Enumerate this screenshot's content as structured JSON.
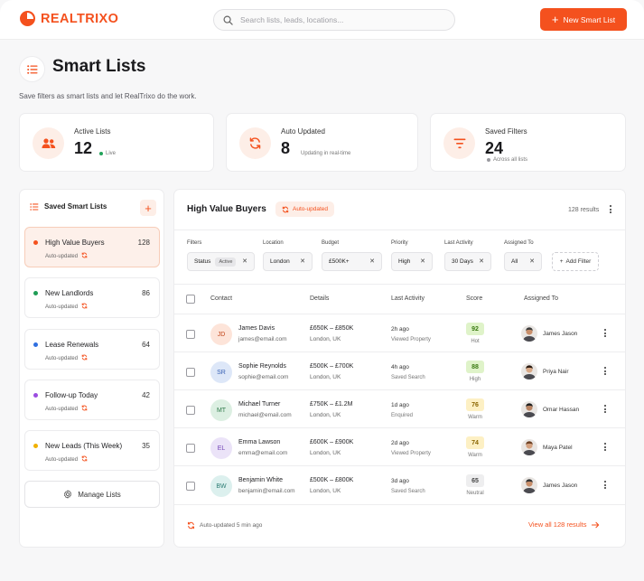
{
  "brand": {
    "name": "REALTRIXO",
    "accent": "#f4511e"
  },
  "search": {
    "placeholder": "Search lists, leads, locations..."
  },
  "header": {
    "new_button_label": "New Smart List"
  },
  "page": {
    "title": "Smart Lists",
    "subtitle": "Save filters as smart lists and let RealTrixo do the work."
  },
  "stats": [
    {
      "label": "Active Lists",
      "value": "12",
      "meta": "Live",
      "meta_color": "#22a35a",
      "icon": "users-icon"
    },
    {
      "label": "Auto Updated",
      "value": "8",
      "meta": "Updating in real-time",
      "meta_color": "",
      "icon": "refresh-icon"
    },
    {
      "label": "Saved Filters",
      "value": "24",
      "meta": "Across all lists",
      "meta_color": "#9a9aa0",
      "icon": "filter-icon"
    }
  ],
  "sidebar": {
    "title": "Saved Smart Lists",
    "items": [
      {
        "name": "High Value Buyers",
        "count": "128",
        "sub": "Auto-updated",
        "color": "#f4511e",
        "active": true
      },
      {
        "name": "New Landlords",
        "count": "86",
        "sub": "Auto-updated",
        "color": "#1f9d55",
        "active": false
      },
      {
        "name": "Lease Renewals",
        "count": "64",
        "sub": "Auto-updated",
        "color": "#2f6fe0",
        "active": false
      },
      {
        "name": "Follow-up Today",
        "count": "42",
        "sub": "Auto-updated",
        "color": "#9b4de0",
        "active": false
      },
      {
        "name": "New Leads (This Week)",
        "count": "35",
        "sub": "Auto-updated",
        "color": "#f0b000",
        "active": false
      }
    ],
    "manage_label": "Manage Lists"
  },
  "main": {
    "title": "High Value Buyers",
    "badge": "Auto-updated",
    "results": "128 results",
    "filters": [
      {
        "label": "Filters",
        "value": "Status",
        "pill": "Active"
      },
      {
        "label": "Location",
        "value": "London",
        "pill": ""
      },
      {
        "label": "Budget",
        "value": "£500K+",
        "pill": ""
      },
      {
        "label": "Priority",
        "value": "High",
        "pill": ""
      },
      {
        "label": "Last Activity",
        "value": "30 Days",
        "pill": ""
      },
      {
        "label": "Assigned To",
        "value": "All",
        "pill": ""
      }
    ],
    "add_filter_label": "Add Filter",
    "columns": [
      "Contact",
      "Details",
      "Last Activity",
      "Score",
      "Assigned To"
    ],
    "rows": [
      {
        "initials": "JD",
        "name": "James Davis",
        "email": "james@email.com",
        "price": "£650K – £850K",
        "location": "London, UK",
        "activity": "2h ago",
        "activity_sub": "Viewed Property",
        "score": "92",
        "score_label": "Hot",
        "score_bg": "#dff3c9",
        "score_fg": "#3a7a12",
        "av_bg": "#fde4d9",
        "av_fg": "#c2461b",
        "assignee": "James Jason"
      },
      {
        "initials": "SR",
        "name": "Sophie Reynolds",
        "email": "sophie@email.com",
        "price": "£500K – £700K",
        "location": "London, UK",
        "activity": "4h ago",
        "activity_sub": "Saved Search",
        "score": "88",
        "score_label": "High",
        "score_bg": "#dff3c9",
        "score_fg": "#3a7a12",
        "av_bg": "#dde7f8",
        "av_fg": "#3b63b5",
        "assignee": "Priya Nair"
      },
      {
        "initials": "MT",
        "name": "Michael Turner",
        "email": "michael@email.com",
        "price": "£750K – £1.2M",
        "location": "London, UK",
        "activity": "1d ago",
        "activity_sub": "Enquired",
        "score": "76",
        "score_label": "Warm",
        "score_bg": "#fdf0c4",
        "score_fg": "#8a6500",
        "av_bg": "#dcefe2",
        "av_fg": "#2f7a4a",
        "assignee": "Omar Hassan"
      },
      {
        "initials": "EL",
        "name": "Emma Lawson",
        "email": "emma@email.com",
        "price": "£600K – £900K",
        "location": "London, UK",
        "activity": "2d ago",
        "activity_sub": "Viewed Property",
        "score": "74",
        "score_label": "Warm",
        "score_bg": "#fdf0c4",
        "score_fg": "#8a6500",
        "av_bg": "#ebe3f8",
        "av_fg": "#7446b8",
        "assignee": "Maya Patel"
      },
      {
        "initials": "BW",
        "name": "Benjamin White",
        "email": "benjamin@email.com",
        "price": "£500K – £800K",
        "location": "London, UK",
        "activity": "3d ago",
        "activity_sub": "Saved Search",
        "score": "65",
        "score_label": "Neutral",
        "score_bg": "#eeeeef",
        "score_fg": "#444444",
        "av_bg": "#dcf0ee",
        "av_fg": "#2d7d74",
        "assignee": "James Jason"
      }
    ],
    "footer_auto": "Auto-updated 5 min ago",
    "footer_link": "View all 128 results"
  }
}
